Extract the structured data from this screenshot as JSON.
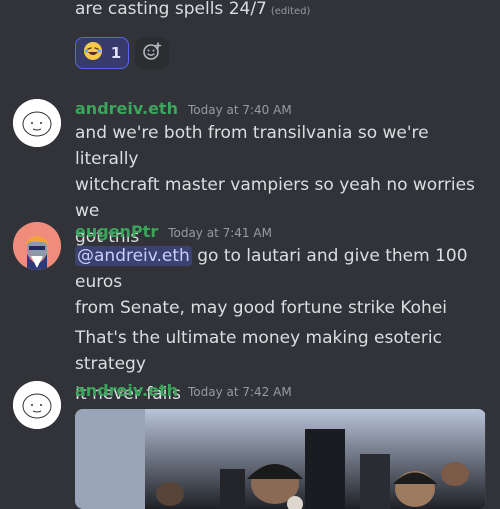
{
  "messages": {
    "previous": {
      "text": "are casting spells 24/7",
      "edited": "(edited)"
    },
    "reaction": {
      "emoji_icon": "laughing-face-emoji",
      "count": "1"
    },
    "msg1": {
      "author": "andreiv.eth",
      "timestamp": "Today at 7:40 AM",
      "lines": [
        "and we're both from transilvania so we're literally",
        "witchcraft master vampiers so yeah no worries we",
        "got this"
      ]
    },
    "msg2": {
      "author": "eugenPtr",
      "timestamp": "Today at 7:41 AM",
      "mention": "@andreiv.eth",
      "line1_rest": " go to lautari and give them 100 euros",
      "line2": "from Senate, may good fortune strike Kohei",
      "line3": "That's the ultimate money making esoteric strategy",
      "line4": "It never fails"
    },
    "msg3": {
      "author": "andreiv.eth",
      "timestamp": "Today at 7:42 AM"
    }
  },
  "colors": {
    "background": "#313338",
    "username_green": "#3ba55c",
    "mention_bg": "#3c4270",
    "reaction_border": "#5865f2"
  }
}
